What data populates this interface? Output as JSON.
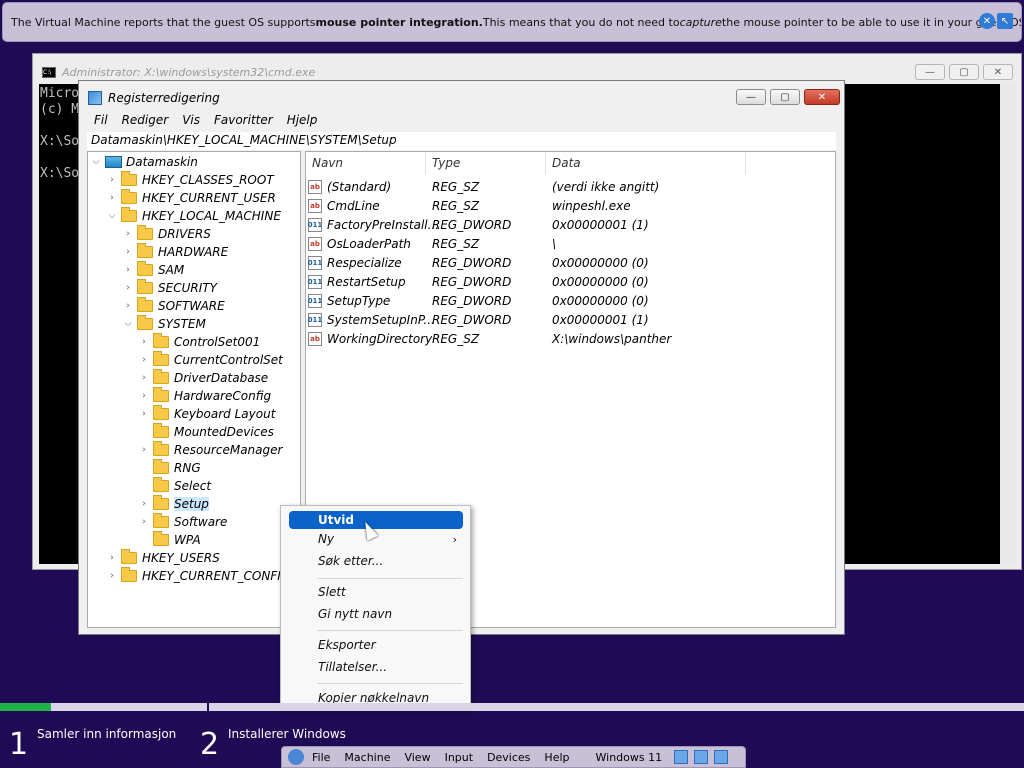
{
  "notification": {
    "part1": "The Virtual Machine reports that the guest OS supports ",
    "bold": "mouse pointer integration.",
    "part2": " This means that you do not need to ",
    "italic": "capture",
    "part3": " the mouse pointer to be able to use it in your guest OS -- all mouse"
  },
  "cmd": {
    "title": "Administrator: X:\\windows\\system32\\cmd.exe",
    "console_text": "Micro\n(c) M\n\nX:\\So\n\nX:\\So",
    "btn_min": "—",
    "btn_max": "▢",
    "btn_close": "✕"
  },
  "regedit": {
    "title": "Registerredigering",
    "btn_min": "—",
    "btn_max": "▢",
    "btn_close": "✕",
    "menu": [
      "Fil",
      "Rediger",
      "Vis",
      "Favoritter",
      "Hjelp"
    ],
    "address": "Datamaskin\\HKEY_LOCAL_MACHINE\\SYSTEM\\Setup",
    "tree": [
      {
        "label": "Datamaskin",
        "arrow": "⌵",
        "icon": "computer"
      },
      {
        "label": "HKEY_CLASSES_ROOT",
        "arrow": "›",
        "icon": "folder"
      },
      {
        "label": "HKEY_CURRENT_USER",
        "arrow": "›",
        "icon": "folder"
      },
      {
        "label": "HKEY_LOCAL_MACHINE",
        "arrow": "⌵",
        "icon": "folder"
      },
      {
        "label": "DRIVERS",
        "arrow": "›",
        "icon": "folder"
      },
      {
        "label": "HARDWARE",
        "arrow": "›",
        "icon": "folder"
      },
      {
        "label": "SAM",
        "arrow": "›",
        "icon": "folder"
      },
      {
        "label": "SECURITY",
        "arrow": "›",
        "icon": "folder"
      },
      {
        "label": "SOFTWARE",
        "arrow": "›",
        "icon": "folder"
      },
      {
        "label": "SYSTEM",
        "arrow": "⌵",
        "icon": "folder"
      },
      {
        "label": "ControlSet001",
        "arrow": "›",
        "icon": "folder"
      },
      {
        "label": "CurrentControlSet",
        "arrow": "›",
        "icon": "folder"
      },
      {
        "label": "DriverDatabase",
        "arrow": "›",
        "icon": "folder"
      },
      {
        "label": "HardwareConfig",
        "arrow": "›",
        "icon": "folder"
      },
      {
        "label": "Keyboard Layout",
        "arrow": "›",
        "icon": "folder"
      },
      {
        "label": "MountedDevices",
        "arrow": "",
        "icon": "folder"
      },
      {
        "label": "ResourceManager",
        "arrow": "›",
        "icon": "folder"
      },
      {
        "label": "RNG",
        "arrow": "",
        "icon": "folder"
      },
      {
        "label": "Select",
        "arrow": "",
        "icon": "folder"
      },
      {
        "label": "Setup",
        "arrow": "›",
        "icon": "folder",
        "selected": true
      },
      {
        "label": "Software",
        "arrow": "›",
        "icon": "folder"
      },
      {
        "label": "WPA",
        "arrow": "",
        "icon": "folder"
      },
      {
        "label": "HKEY_USERS",
        "arrow": "›",
        "icon": "folder"
      },
      {
        "label": "HKEY_CURRENT_CONFIG",
        "arrow": "›",
        "icon": "folder"
      }
    ],
    "columns": {
      "name": "Navn",
      "type": "Type",
      "data": "Data"
    },
    "values": [
      {
        "name": "(Standard)",
        "type": "REG_SZ",
        "data": "(verdi ikke angitt)",
        "icon": "string-value-icon"
      },
      {
        "name": "CmdLine",
        "type": "REG_SZ",
        "data": "winpeshl.exe",
        "icon": "string-value-icon"
      },
      {
        "name": "FactoryPreInstall...",
        "type": "REG_DWORD",
        "data": "0x00000001 (1)",
        "icon": "binary-value-icon"
      },
      {
        "name": "OsLoaderPath",
        "type": "REG_SZ",
        "data": "\\",
        "icon": "string-value-icon"
      },
      {
        "name": "Respecialize",
        "type": "REG_DWORD",
        "data": "0x00000000 (0)",
        "icon": "binary-value-icon"
      },
      {
        "name": "RestartSetup",
        "type": "REG_DWORD",
        "data": "0x00000000 (0)",
        "icon": "binary-value-icon"
      },
      {
        "name": "SetupType",
        "type": "REG_DWORD",
        "data": "0x00000000 (0)",
        "icon": "binary-value-icon"
      },
      {
        "name": "SystemSetupInP...",
        "type": "REG_DWORD",
        "data": "0x00000001 (1)",
        "icon": "binary-value-icon"
      },
      {
        "name": "WorkingDirectory",
        "type": "REG_SZ",
        "data": "X:\\windows\\panther",
        "icon": "string-value-icon"
      }
    ]
  },
  "context_menu": {
    "items": [
      {
        "label": "Utvid",
        "highlighted": true
      },
      {
        "label": "Ny",
        "submenu": "›"
      },
      {
        "label": "Søk etter..."
      },
      {
        "label": "Slett"
      },
      {
        "label": "Gi nytt navn"
      },
      {
        "label": "Eksporter"
      },
      {
        "label": "Tillatelser..."
      },
      {
        "label": "Kopier nøkkelnavn"
      }
    ]
  },
  "setup_steps": [
    {
      "num": "1",
      "label": "Samler inn informasjon"
    },
    {
      "num": "2",
      "label": "Installerer Windows"
    }
  ],
  "setup_progress": 0.05,
  "vbox_toolbar": {
    "menus": [
      "File",
      "Machine",
      "View",
      "Input",
      "Devices",
      "Help"
    ],
    "vm_name": "Windows 11"
  },
  "colors": {
    "background": "#1f0a55",
    "progress": "#21b34a",
    "menu_highlight": "#0b62c9"
  }
}
